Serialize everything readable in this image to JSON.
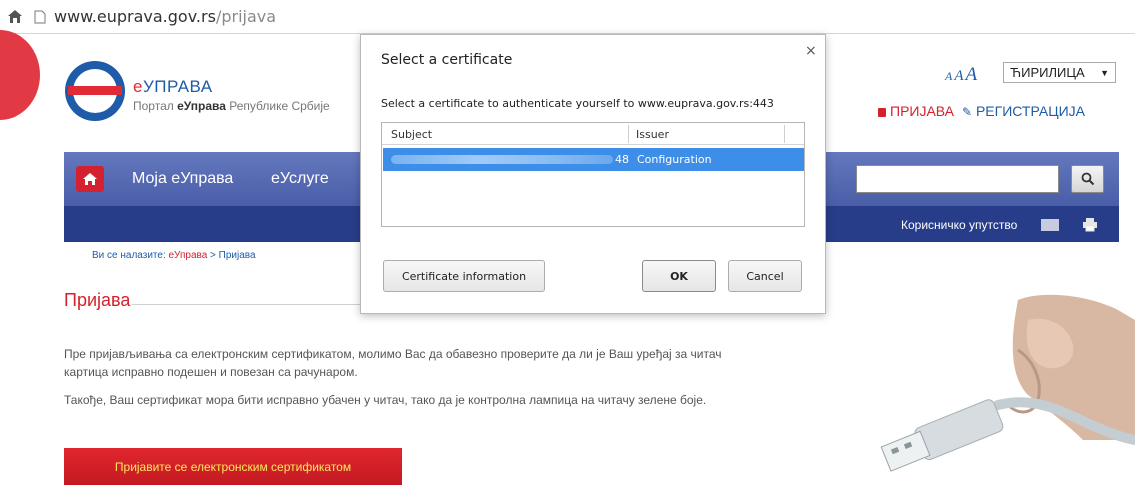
{
  "browser": {
    "url_host": "www.euprava.gov.rs",
    "url_path": "/prijava"
  },
  "site": {
    "brand_prefix": "е",
    "brand_main": "УПРАВА",
    "tagline_prefix": "Портал ",
    "tagline_bold": "еУправа",
    "tagline_suffix": " Републике Србије",
    "font_size_labels": [
      "A",
      "A",
      "A"
    ],
    "language": "ЋИРИЛИЦА",
    "login_label": "ПРИЈАВА",
    "register_label": "РЕГИСТРАЦИЈА",
    "colors": {
      "brand_blue": "#1e5ba8",
      "brand_red": "#d6202c",
      "nav_blue": "#4a5ea8",
      "subnav_blue": "#283d8a"
    }
  },
  "nav": {
    "items": [
      "Моја еУправа",
      "еУслуге"
    ],
    "search_placeholder": "",
    "manual_label": "Корисничко упутство"
  },
  "breadcrumb": {
    "prefix": "Ви се налазите: ",
    "root": "еУправа",
    "separator": " > ",
    "current": "Пријава"
  },
  "content": {
    "title": "Пријава",
    "paragraph1": "Пре пријављивања са електронским сертификатом, молимо Вас да обавезно проверите да ли је Ваш уређај за читач картица исправно подешен и повезан са рачунаром.",
    "paragraph2": "Такође, Ваш сертификат мора бити исправно убачен у читач, тако да је контролна лампица на читачу зелене боје.",
    "cert_button": "Пријавите се електронским сертификатом"
  },
  "dialog": {
    "title": "Select a certificate",
    "close": "×",
    "description": "Select a certificate to authenticate yourself to www.euprava.gov.rs:443",
    "columns": [
      "Subject",
      "Issuer"
    ],
    "rows": [
      {
        "subject_visible_suffix": "48",
        "issuer": "Configuration",
        "selected": true
      }
    ],
    "info_button": "Certificate information",
    "ok_button": "OK",
    "cancel_button": "Cancel"
  }
}
